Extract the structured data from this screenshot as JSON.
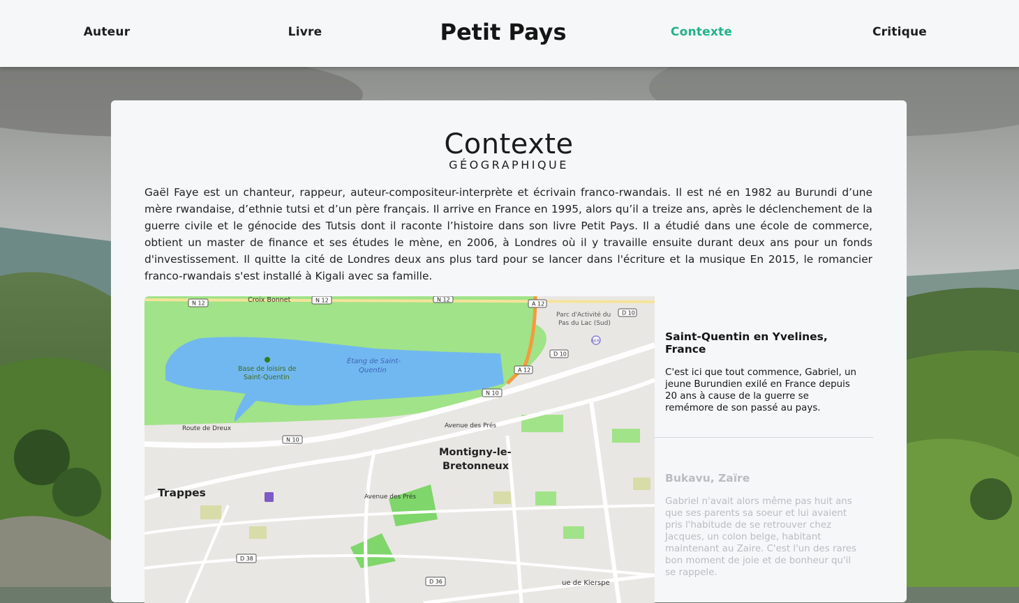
{
  "nav": {
    "items": [
      {
        "label": "Auteur",
        "active": false
      },
      {
        "label": "Livre",
        "active": false
      },
      {
        "label": "Contexte",
        "active": true
      },
      {
        "label": "Critique",
        "active": false
      }
    ],
    "brand": "Petit Pays",
    "accent_color": "#1fb38a"
  },
  "section": {
    "title": "Contexte",
    "subtitle": "GÉOGRAPHIQUE",
    "intro": "Gaël Faye est un chanteur, rappeur, auteur-compositeur-interprète et écrivain franco-rwandais. Il est né en 1982 au Burundi d’une mère rwandaise, d’ethnie tutsi et d’un père français. Il arrive en France en 1995, alors qu’il a treize ans, après le déclenchement de la guerre civile et le génocide des Tutsis dont il raconte l’histoire dans son livre Petit Pays. Il a étudié dans une école de commerce, obtient un master de finance et ses études le mène, en 2006, à Londres où il y travaille ensuite durant deux ans pour un fonds d'investissement. Il quitte la cité de Londres deux ans plus tard pour se lancer dans l'écriture et la musique En 2015, le romancier franco-rwandais s'est installé à Kigali avec sa famille."
  },
  "map": {
    "labels": {
      "croix_bonnet": "Croix Bonnet",
      "n12_a": "N 12",
      "n12_b": "N 12",
      "n12_c": "N 12",
      "a12_a": "A 12",
      "a12_b": "A 12",
      "parc_1": "Parc d'Activité du",
      "parc_2": "Pas du Lac (Sud)",
      "d10_a": "D 10",
      "d10_b": "D 10",
      "rer": "RER",
      "base_1": "Base de loisirs de",
      "base_2": "Saint-Quentin",
      "etang_1": "Étang de Saint-",
      "etang_2": "Quentin",
      "n10_a": "N 10",
      "n10_b": "N 10",
      "route_dreux": "Route de Dreux",
      "avenue_pres_1": "Avenue des Prés",
      "avenue_pres_2": "Avenue des Prés",
      "montigny_1": "Montigny-le-",
      "montigny_2": "Bretonneux",
      "trappes": "Trappes",
      "d38": "D 38",
      "d36": "D 36",
      "kierspe": "ue de Kierspe"
    }
  },
  "places": [
    {
      "name": "Saint-Quentin en Yvelines, France",
      "text": "C'est ici que tout commence, Gabriel, un jeune Burundien exilé en France depuis 20 ans à cause de la guerre se remémore de son passé au pays.",
      "active": true
    },
    {
      "name": "Bukavu, Zaïre",
      "text": "Gabriel n'avait alors même pas huit ans que ses parents sa soeur et lui avaient pris l'habitude de se retrouver chez Jacques, un colon belge, habitant maintenant au Zaire. C'est l'un des rares bon moment de joie et de bonheur qu'il se rappele.",
      "active": false
    }
  ]
}
